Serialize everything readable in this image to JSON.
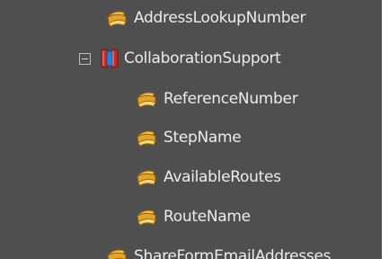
{
  "tree": {
    "nodes": [
      {
        "label": "AddressLookupNumber",
        "icon": "field-icon"
      },
      {
        "label": "CollaborationSupport",
        "icon": "class-icon",
        "expander": "collapse"
      },
      {
        "label": "ReferenceNumber",
        "icon": "field-icon"
      },
      {
        "label": "StepName",
        "icon": "field-icon"
      },
      {
        "label": "AvailableRoutes",
        "icon": "field-icon"
      },
      {
        "label": "RouteName",
        "icon": "field-icon"
      },
      {
        "label": "ShareFormEmailAddresses",
        "icon": "field-icon"
      }
    ]
  },
  "colors": {
    "panel_background": "#4f4f4f",
    "label_text": "#ececec"
  }
}
